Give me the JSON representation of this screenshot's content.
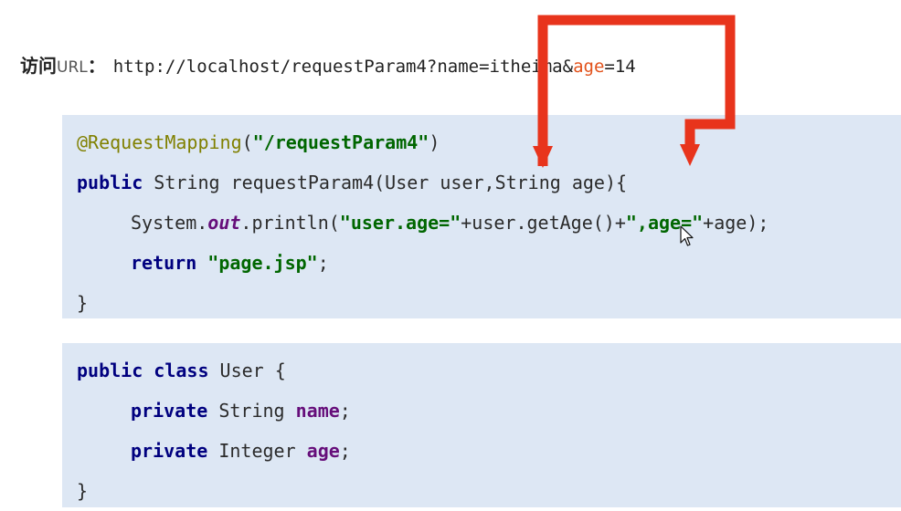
{
  "url": {
    "label_cn": "访问",
    "label_en": "URL",
    "colon": "：",
    "prefix": "http://localhost/requestParam4?name=itheima&",
    "highlight": "age",
    "suffix": "=14"
  },
  "method_block": {
    "annotation": "@RequestMapping",
    "annotation_open": "(",
    "annotation_value": "\"/requestParam4\"",
    "annotation_close": ")",
    "kw_public": "public",
    "signature": " String requestParam4(User user,String age){",
    "sysout_prefix": "System.",
    "sysout_out": "out",
    "sysout_println": ".println(",
    "str_user_age": "\"user.age=\"",
    "concat_getage": "+user.getAge()+",
    "str_age": "\",age=\"",
    "concat_end": "+age);",
    "kw_return": "return",
    "return_value": "\"page.jsp\"",
    "return_end": ";",
    "closing_brace": "}"
  },
  "class_block": {
    "kw_public": "public",
    "kw_class": "class",
    "class_name": " User {",
    "field1_kw": "private",
    "field1_type": " String ",
    "field1_name": "name",
    "field1_end": ";",
    "field2_kw": "private",
    "field2_type": " Integer ",
    "field2_name": "age",
    "field2_end": ";",
    "closing_brace": "}"
  },
  "colors": {
    "arrow": "#e8341c",
    "code_background": "#dde7f4",
    "keyword": "#00007f",
    "string": "#006600",
    "annotation": "#808000",
    "field": "#660e7a",
    "url_highlight": "#e2521b"
  },
  "icons": [
    "arrow-to-user-param",
    "arrow-to-age-param",
    "mouse-pointer-icon"
  ]
}
